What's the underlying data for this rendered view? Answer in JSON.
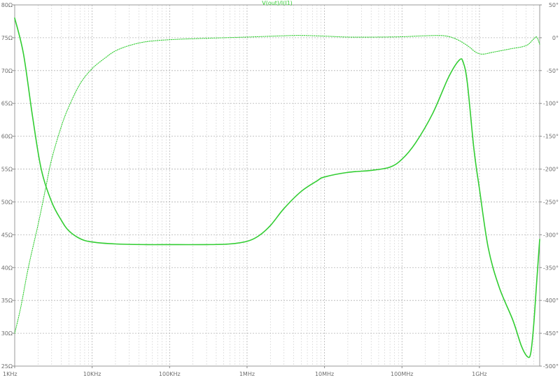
{
  "chart_data": {
    "type": "line",
    "title": "V(out)/I(I1)",
    "x_scale": "log",
    "x_range_hz": [
      1000,
      6000000000
    ],
    "x_ticks": [
      {
        "value": 1000,
        "label": "1KHz"
      },
      {
        "value": 10000,
        "label": "10KHz"
      },
      {
        "value": 100000,
        "label": "100KHz"
      },
      {
        "value": 1000000,
        "label": "1MHz"
      },
      {
        "value": 10000000,
        "label": "10MHz"
      },
      {
        "value": 100000000,
        "label": "100MHz"
      },
      {
        "value": 1000000000,
        "label": "1GHz"
      }
    ],
    "y_left": {
      "range": [
        25,
        80
      ],
      "ticks": [
        {
          "value": 80,
          "label": "80Ω"
        },
        {
          "value": 75,
          "label": "75Ω"
        },
        {
          "value": 70,
          "label": "70Ω"
        },
        {
          "value": 65,
          "label": "65Ω"
        },
        {
          "value": 60,
          "label": "60Ω"
        },
        {
          "value": 55,
          "label": "55Ω"
        },
        {
          "value": 50,
          "label": "50Ω"
        },
        {
          "value": 45,
          "label": "45Ω"
        },
        {
          "value": 40,
          "label": "40Ω"
        },
        {
          "value": 35,
          "label": "35Ω"
        },
        {
          "value": 30,
          "label": "30Ω"
        },
        {
          "value": 25,
          "label": "25Ω"
        }
      ]
    },
    "y_right": {
      "range": [
        -500,
        50
      ],
      "ticks": [
        {
          "value": 50,
          "label": "50°"
        },
        {
          "value": 0,
          "label": "0°"
        },
        {
          "value": -50,
          "label": "-50°"
        },
        {
          "value": -100,
          "label": "-100°"
        },
        {
          "value": -150,
          "label": "-150°"
        },
        {
          "value": -200,
          "label": "-200°"
        },
        {
          "value": -250,
          "label": "-250°"
        },
        {
          "value": -300,
          "label": "-300°"
        },
        {
          "value": -350,
          "label": "-350°"
        },
        {
          "value": -400,
          "label": "-400°"
        },
        {
          "value": -450,
          "label": "-450°"
        },
        {
          "value": -500,
          "label": "-500°"
        }
      ]
    },
    "grid": true,
    "series": [
      {
        "axis": "left",
        "style": "solid",
        "color": "#32cd32",
        "points": [
          [
            1000,
            78
          ],
          [
            1300,
            72.5
          ],
          [
            1700,
            63
          ],
          [
            2200,
            55
          ],
          [
            3000,
            50
          ],
          [
            4000,
            47.2
          ],
          [
            5000,
            45.6
          ],
          [
            7000,
            44.4
          ],
          [
            10000,
            43.9
          ],
          [
            20000,
            43.6
          ],
          [
            50000,
            43.5
          ],
          [
            100000,
            43.5
          ],
          [
            300000,
            43.5
          ],
          [
            600000,
            43.6
          ],
          [
            1000000,
            44.0
          ],
          [
            1400000,
            44.8
          ],
          [
            2000000,
            46.4
          ],
          [
            3000000,
            49.0
          ],
          [
            5000000,
            51.6
          ],
          [
            8000000,
            53.2
          ],
          [
            10000000,
            53.8
          ],
          [
            20000000,
            54.5
          ],
          [
            40000000,
            54.8
          ],
          [
            70000000,
            55.3
          ],
          [
            100000000,
            56.5
          ],
          [
            150000000,
            59
          ],
          [
            250000000,
            63.5
          ],
          [
            400000000,
            69
          ],
          [
            550000000,
            71.6
          ],
          [
            620000000,
            71.2
          ],
          [
            700000000,
            68
          ],
          [
            850000000,
            58
          ],
          [
            1000000000,
            52
          ],
          [
            1300000000,
            43
          ],
          [
            1800000000,
            37
          ],
          [
            2700000000,
            32
          ],
          [
            3500000000,
            28
          ],
          [
            4200000000,
            26.4
          ],
          [
            4600000000,
            27
          ],
          [
            5000000000,
            31
          ],
          [
            5500000000,
            38
          ],
          [
            6000000000,
            44.3
          ]
        ]
      },
      {
        "axis": "right",
        "style": "dotted",
        "color": "#32cd32",
        "points": [
          [
            1000,
            -450
          ],
          [
            1200,
            -410
          ],
          [
            1500,
            -350
          ],
          [
            2000,
            -285
          ],
          [
            2500,
            -230
          ],
          [
            3000,
            -185
          ],
          [
            4000,
            -135
          ],
          [
            5000,
            -105
          ],
          [
            7000,
            -70
          ],
          [
            10000,
            -47
          ],
          [
            15000,
            -30
          ],
          [
            20000,
            -20
          ],
          [
            30000,
            -12
          ],
          [
            50000,
            -6
          ],
          [
            100000,
            -3
          ],
          [
            200000,
            -1.5
          ],
          [
            500000,
            0
          ],
          [
            1000000,
            1
          ],
          [
            3000000,
            3
          ],
          [
            5000000,
            3.5
          ],
          [
            10000000,
            2.5
          ],
          [
            20000000,
            1
          ],
          [
            50000000,
            1
          ],
          [
            100000000,
            1.5
          ],
          [
            200000000,
            3
          ],
          [
            350000000,
            3
          ],
          [
            500000000,
            -2
          ],
          [
            700000000,
            -12
          ],
          [
            900000000,
            -22
          ],
          [
            1100000000,
            -25
          ],
          [
            1500000000,
            -22
          ],
          [
            2500000000,
            -17
          ],
          [
            4000000000,
            -12
          ],
          [
            5000000000,
            -2
          ],
          [
            5500000000,
            1
          ],
          [
            6000000000,
            -10
          ]
        ]
      }
    ]
  }
}
